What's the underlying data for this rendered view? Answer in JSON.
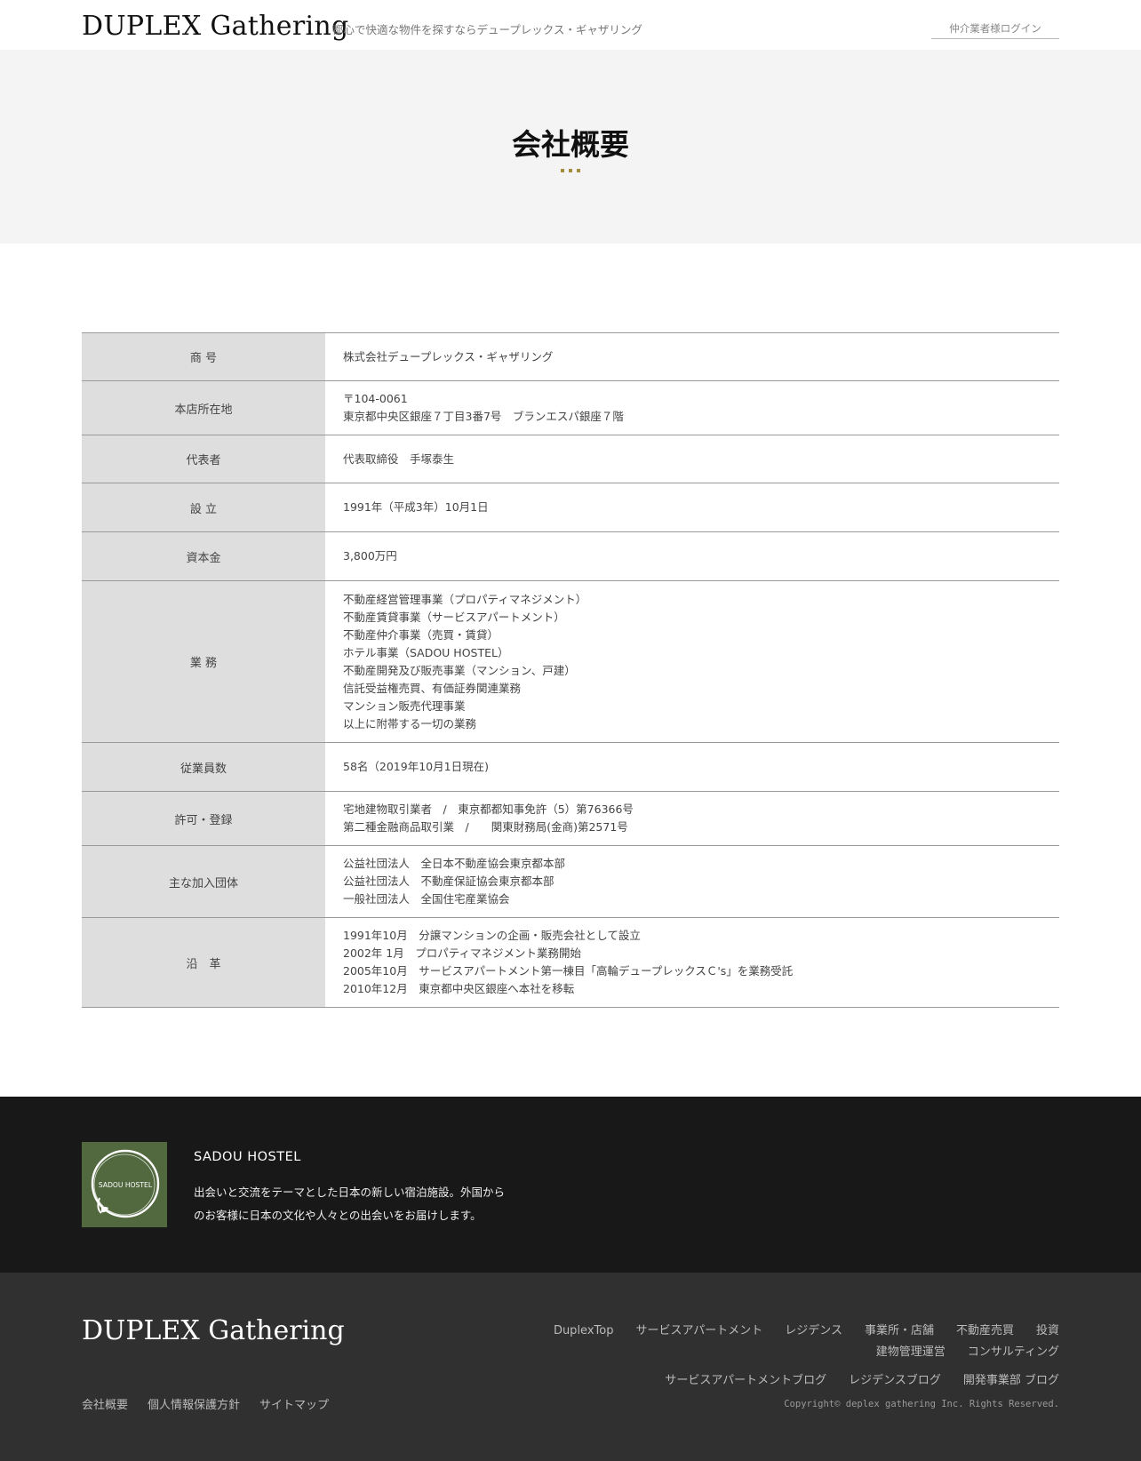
{
  "header": {
    "logo": "DUPLEX Gathering",
    "tagline": "都心で快適な物件を探すならデュープレックス・ギャザリング",
    "login_link": "仲介業者様ログイン"
  },
  "hero": {
    "title": "会社概要",
    "accent_color": "#a48c3a"
  },
  "company_info": {
    "rows": [
      {
        "label": "商 号",
        "lines": [
          "株式会社デュープレックス・ギャザリング"
        ]
      },
      {
        "label": "本店所在地",
        "lines": [
          "〒104-0061",
          "東京都中央区銀座７丁目3番7号　ブランエスパ銀座７階"
        ]
      },
      {
        "label": "代表者",
        "lines": [
          "代表取締役　手塚泰生"
        ]
      },
      {
        "label": "設 立",
        "lines": [
          "1991年（平成3年）10月1日"
        ]
      },
      {
        "label": "資本金",
        "lines": [
          "3,800万円"
        ]
      },
      {
        "label": "業 務",
        "lines": [
          "不動産経営管理事業（プロパティマネジメント）",
          "不動産賃貸事業（サービスアパートメント）",
          "不動産仲介事業（売買・賃貸）",
          "ホテル事業（SADOU HOSTEL）",
          "不動産開発及び販売事業（マンション、戸建）",
          "信託受益権売買、有価証券関連業務",
          "マンション販売代理事業",
          "以上に附帯する一切の業務"
        ]
      },
      {
        "label": "従業員数",
        "lines": [
          "58名（2019年10月1日現在)"
        ]
      },
      {
        "label": "許可・登録",
        "lines": [
          "宅地建物取引業者　/　東京都都知事免許（5）第76366号",
          "第二種金融商品取引業　/　　関東財務局(金商)第2571号"
        ]
      },
      {
        "label": "主な加入団体",
        "lines": [
          "公益社団法人　全日本不動産協会東京都本部",
          "公益社団法人　不動産保証協会東京都本部",
          "一般社団法人　全国住宅産業協会"
        ]
      },
      {
        "label": "沿　革",
        "lines": [
          "1991年10月　分譲マンションの企画・販売会社として設立",
          "2002年  1月　プロパティマネジメント業務開始",
          "2005年10月　サービスアパートメント第一棟目「高輪デュープレックスＣ's」を業務受託",
          "2010年12月　東京都中央区銀座へ本社を移転"
        ]
      }
    ]
  },
  "hostel": {
    "logo_text": "SADOU HOSTEL",
    "title": "SADOU HOSTEL",
    "description": [
      "出会いと交流をテーマとした日本の新しい宿泊施設。外国から",
      "のお客様に日本の文化や人々との出会いをお届けします。"
    ]
  },
  "footer": {
    "logo": "DUPLEX Gathering",
    "nav": [
      "DuplexTop",
      "サービスアパートメント",
      "レジデンス",
      "事業所・店舗",
      "不動産売買",
      "投資",
      "建物管理運営",
      "コンサルティング"
    ],
    "nav_blogs": [
      "サービスアパートメントブログ",
      "レジデンスブログ",
      "開発事業部 ブログ"
    ],
    "links": [
      "会社概要",
      "個人情報保護方針",
      "サイトマップ"
    ],
    "copyright": "Copyright© deplex gathering Inc. Rights Reserved."
  }
}
